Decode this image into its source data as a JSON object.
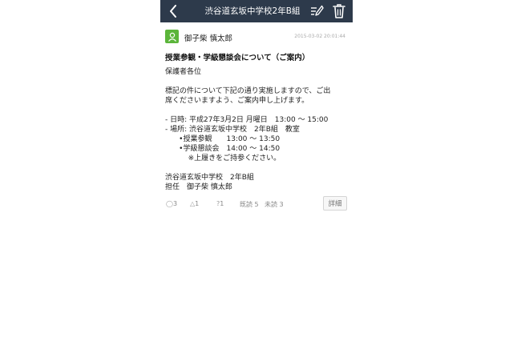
{
  "header": {
    "title": "渋谷道玄坂中学校2年B組"
  },
  "post": {
    "author": "御子柴 慎太郎",
    "timestamp": "2015-03-02 20:01:44",
    "title": "授業参観・学級懇談会について（ご案内）",
    "body_lines": [
      "保護者各位",
      "",
      "標記の件について下記の通り実施しますので、ご出",
      "席くださいますよう、ご案内申し上げます。",
      "",
      "- 日時: 平成27年3月2日 月曜日　13:00 ～ 15:00",
      "- 場所: 渋谷道玄坂中学校　2年B組　教室",
      "      •授業参観　　13:00 ～ 13:50",
      "      •学級懇談会　14:00 ～ 14:50",
      "          ※上履きをご持参ください。",
      "",
      "渋谷道玄坂中学校　2年B組",
      "担任　御子柴 慎太郎"
    ]
  },
  "footer": {
    "circle_glyph": "◯",
    "circle_count": "3",
    "triangle_glyph": "△",
    "triangle_count": "1",
    "question_glyph": "?",
    "question_count": "1",
    "read": "既読 5",
    "unread": "未読 3",
    "detail_label": "詳細"
  },
  "colors": {
    "navbar": "#2d3a4b",
    "avatar": "#5bb53a"
  }
}
